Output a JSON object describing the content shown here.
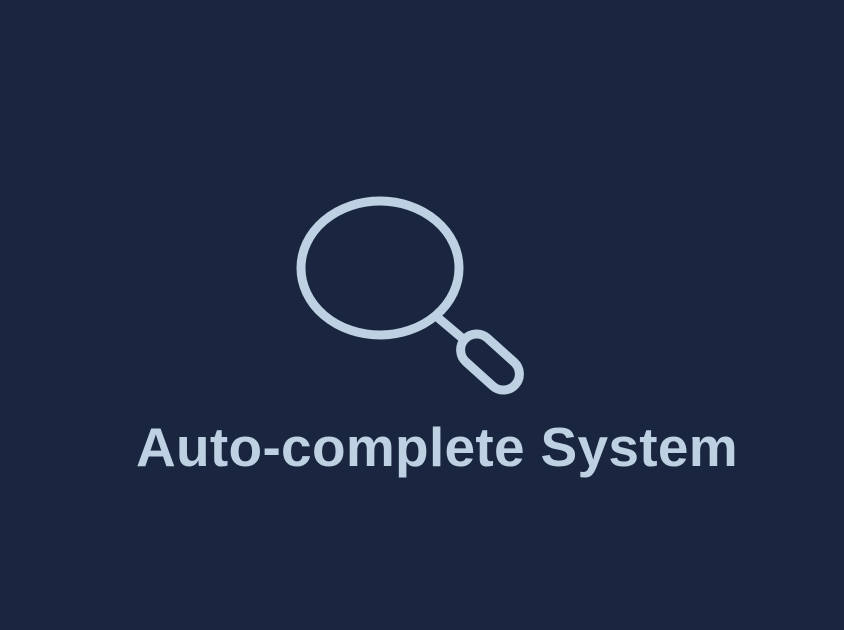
{
  "title": "Auto-complete System",
  "icon": "search-icon",
  "colors": {
    "background": "#1a2640",
    "foreground": "#bdd1e2"
  }
}
